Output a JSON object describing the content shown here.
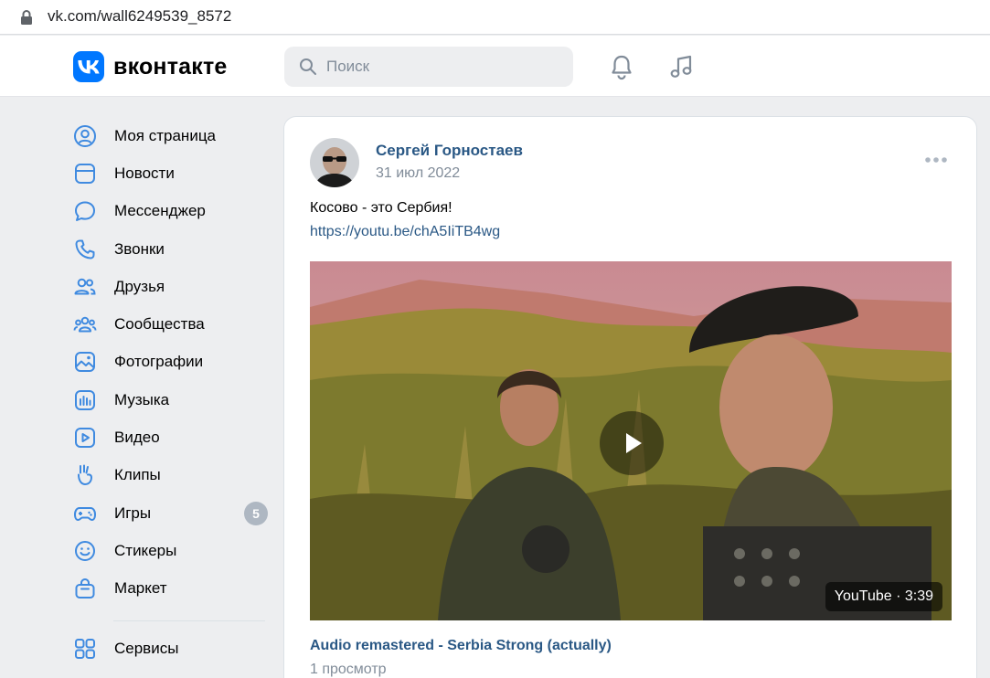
{
  "browser": {
    "url": "vk.com/wall6249539_8572"
  },
  "header": {
    "logo_text": "вконтакте",
    "search_placeholder": "Поиск"
  },
  "colors": {
    "accent": "#0077ff",
    "link": "#2a5885",
    "muted": "#818c99",
    "page_bg": "#edeef0",
    "badge": "#aeb7c2"
  },
  "sidebar": {
    "items": [
      {
        "label": "Моя страница",
        "icon": "user-circle-icon"
      },
      {
        "label": "Новости",
        "icon": "news-icon"
      },
      {
        "label": "Мессенджер",
        "icon": "message-icon"
      },
      {
        "label": "Звонки",
        "icon": "phone-icon"
      },
      {
        "label": "Друзья",
        "icon": "friends-icon"
      },
      {
        "label": "Сообщества",
        "icon": "communities-icon"
      },
      {
        "label": "Фотографии",
        "icon": "photo-icon"
      },
      {
        "label": "Музыка",
        "icon": "music-icon"
      },
      {
        "label": "Видео",
        "icon": "video-icon"
      },
      {
        "label": "Клипы",
        "icon": "clips-icon"
      },
      {
        "label": "Игры",
        "icon": "gamepad-icon",
        "badge": "5"
      },
      {
        "label": "Стикеры",
        "icon": "smile-icon"
      },
      {
        "label": "Маркет",
        "icon": "bag-icon"
      }
    ],
    "services": {
      "label": "Сервисы",
      "icon": "services-icon"
    }
  },
  "post": {
    "author": "Сергей Горностаев",
    "date": "31 июл 2022",
    "text": "Косово - это Сербия!",
    "link": "https://youtu.be/chA5IiTB4wg",
    "video": {
      "badge": "YouTube · 3:39",
      "title": "Audio remastered - Serbia Strong (actually)",
      "views": "1 просмотр"
    }
  }
}
